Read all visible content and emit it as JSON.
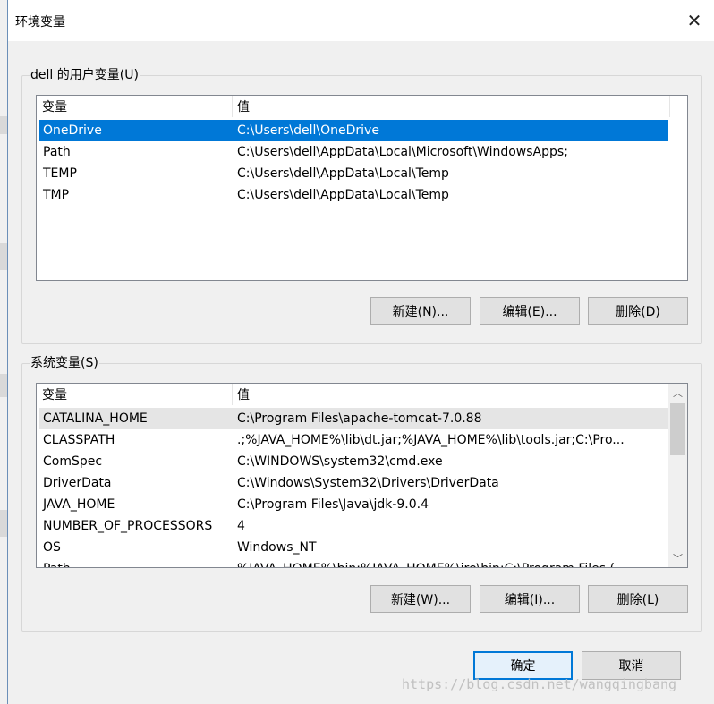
{
  "window": {
    "title": "环境变量",
    "close_glyph": "✕"
  },
  "user_vars": {
    "group_label": "dell 的用户变量(U)",
    "columns": [
      "变量",
      "值"
    ],
    "rows": [
      {
        "name": "OneDrive",
        "value": "C:\\Users\\dell\\OneDrive"
      },
      {
        "name": "Path",
        "value": "C:\\Users\\dell\\AppData\\Local\\Microsoft\\WindowsApps;"
      },
      {
        "name": "TEMP",
        "value": "C:\\Users\\dell\\AppData\\Local\\Temp"
      },
      {
        "name": "TMP",
        "value": "C:\\Users\\dell\\AppData\\Local\\Temp"
      }
    ],
    "buttons": {
      "new": "新建(N)...",
      "edit": "编辑(E)...",
      "delete": "删除(D)"
    }
  },
  "system_vars": {
    "group_label": "系统变量(S)",
    "columns": [
      "变量",
      "值"
    ],
    "rows": [
      {
        "name": "CATALINA_HOME",
        "value": "C:\\Program Files\\apache-tomcat-7.0.88"
      },
      {
        "name": "CLASSPATH",
        "value": ".;%JAVA_HOME%\\lib\\dt.jar;%JAVA_HOME%\\lib\\tools.jar;C:\\Pro..."
      },
      {
        "name": "ComSpec",
        "value": "C:\\WINDOWS\\system32\\cmd.exe"
      },
      {
        "name": "DriverData",
        "value": "C:\\Windows\\System32\\Drivers\\DriverData"
      },
      {
        "name": "JAVA_HOME",
        "value": "C:\\Program Files\\Java\\jdk-9.0.4"
      },
      {
        "name": "NUMBER_OF_PROCESSORS",
        "value": "4"
      },
      {
        "name": "OS",
        "value": "Windows_NT"
      },
      {
        "name": "Path",
        "value": "%JAVA_HOME%\\bin;%JAVA_HOME%\\jre\\bin;C:\\Program Files (..."
      }
    ],
    "buttons": {
      "new": "新建(W)...",
      "edit": "编辑(I)...",
      "delete": "删除(L)"
    },
    "scroll": {
      "up_glyph": "︿",
      "down_glyph": "﹀"
    }
  },
  "footer": {
    "ok": "确定",
    "cancel": "取消"
  },
  "watermark": "https://blog.csdn.net/wangqingbang",
  "colors": {
    "selection": "#0078d7",
    "default_button_border": "#0078d7"
  }
}
